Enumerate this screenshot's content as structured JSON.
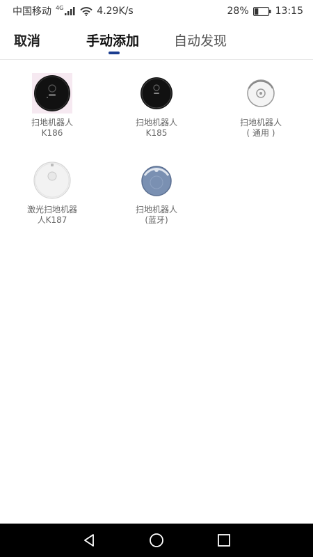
{
  "status_bar": {
    "carrier": "中国移动",
    "network_badge": "4G",
    "speed": "4.29K/s",
    "battery_percent": "28%",
    "battery_level": 0.28,
    "time": "13:15"
  },
  "header": {
    "cancel_label": "取消",
    "tabs": [
      {
        "label": "手动添加",
        "active": true
      },
      {
        "label": "自动发现",
        "active": false
      }
    ]
  },
  "devices": [
    {
      "label": "扫地机器人\nK186",
      "icon": "robot-vacuum-black-icon"
    },
    {
      "label": "扫地机器人\nK185",
      "icon": "robot-vacuum-black-icon"
    },
    {
      "label": "扫地机器人\n( 通用 )",
      "icon": "robot-vacuum-outline-icon"
    },
    {
      "label": "激光扫地机器\n人K187",
      "icon": "robot-vacuum-white-lidar-icon"
    },
    {
      "label": "扫地机器人\n(蓝牙)",
      "icon": "robot-vacuum-blue-icon"
    }
  ],
  "nav_bar": {
    "icons": [
      "back-icon",
      "home-icon",
      "recents-icon"
    ]
  },
  "colors": {
    "accent": "#1a3d8f",
    "nav_bg": "#000000"
  }
}
